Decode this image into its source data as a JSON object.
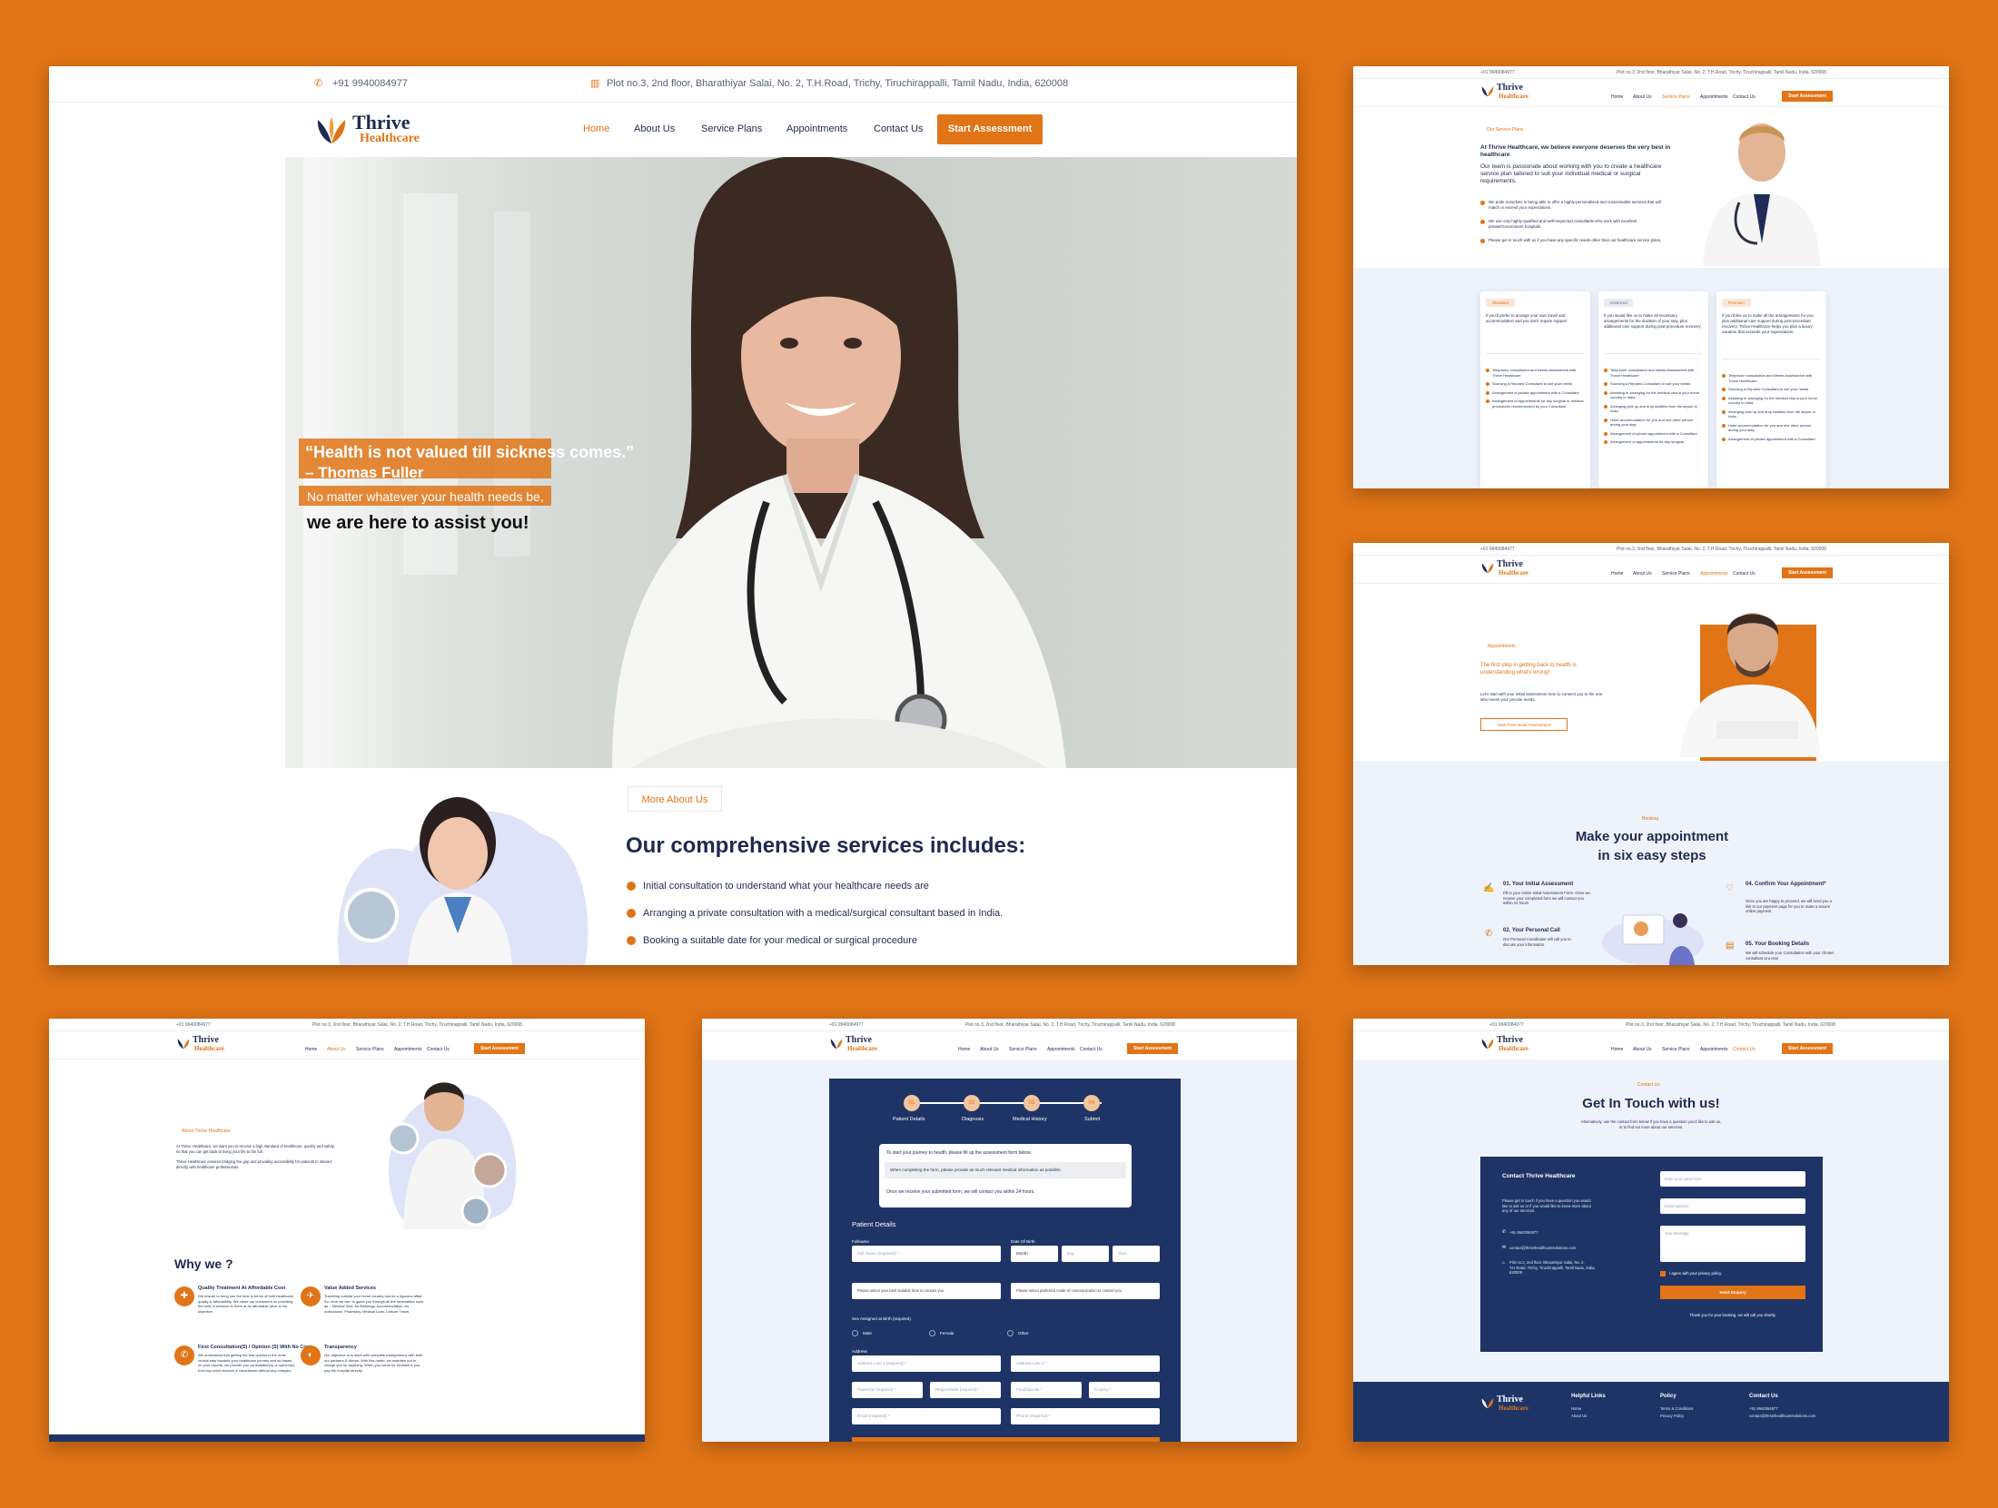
{
  "brand": {
    "name_line1": "Thrive",
    "name_line2": "Healthcare",
    "accent": "#e07416",
    "navy": "#1e2b4f"
  },
  "topbar": {
    "phone": "+91 9940084977",
    "address": "Plot no.3, 2nd floor, Bharathiyar Salai, No. 2, T.H.Road, Trichy, Tiruchirappalli, Tamil Nadu, India, 620008"
  },
  "nav": {
    "home": "Home",
    "about": "About Us",
    "plans": "Service Plans",
    "appointments": "Appointments",
    "contact": "Contact Us",
    "cta": "Start Assessment"
  },
  "hero": {
    "quote_line1": "“Health is not valued till sickness comes.”",
    "quote_line2": "– Thomas Fuller",
    "tagline1": "No matter whatever your health needs be,",
    "tagline2": "we are here to assist you!"
  },
  "services": {
    "more_button": "More About Us",
    "heading": "Our comprehensive services includes:",
    "items": [
      "Initial consultation to understand what your healthcare needs are",
      "Arranging a private consultation with a medical/surgical consultant based in India.",
      "Booking a suitable date for your medical or surgical procedure"
    ]
  },
  "plans_page": {
    "kicker": "Our Service Plans",
    "headline": "At Thrive Healthcare, we believe everyone deserves the very best in healthcare",
    "intro": "Our team is passionate about working with you to create a healthcare service plan tailored to suit your individual medical or surgical requirements.",
    "bullets": [
      "We pride ourselves in being able to offer a highly-personalised and customisable services that will match or exceed your expectations.",
      "We use only highly-qualified and well-respected consultants who work with excellent private/Government hospitals.",
      "Please get in touch with us if you have any specific needs other than our healthcare service plans."
    ],
    "cards": [
      {
        "badge": "Standard",
        "desc": "If you'd prefer to arrange your own travel and accommodation and you don't require support",
        "items": [
          "Telephone consultation and Needs Assessment with Thrive Healthcare",
          "Sourcing a Reputed Consultant to suit your needs",
          "Arrangement of private appointment with a Consultant",
          "Arrangement of appointments for any surgical or medical procedures recommended by your Consultant"
        ]
      },
      {
        "badge": "Advanced",
        "desc": "If you would like us to make all necessary arrangements for the duration of your stay, plus additional care support during post-procedure recovery",
        "items": [
          "Telephone consultation and Needs Assessment with Thrive Healthcare",
          "Sourcing a Reputed Consultant to suit your needs",
          "Assisting in arranging for the medical visa in your home country to India",
          "Arranging pick up and drop facilities from the airport in India",
          "Hotel accommodation for you and one other person during your stay",
          "Arrangement of private appointment with a Consultant",
          "Arrangement of appointments for any surgical"
        ]
      },
      {
        "badge": "Premium",
        "desc": "If you'd like us to make all the arrangements for you, plus additional care support during post-procedure recovery. Thrive Healthcare helps you plan a luxury vacation that exceeds your expectations.",
        "items": [
          "Telephone consultation and Needs Assessment with Thrive Healthcare",
          "Sourcing a Reputed Consultant to suit your needs",
          "Assisting in arranging for the medical visa in your home country to India",
          "Arranging pick up and drop facilities from the airport in India",
          "Hotel accommodation for you and one other person during your stay",
          "Arrangement of private appointment with a Consultant"
        ]
      }
    ]
  },
  "appt_page": {
    "kicker": "Appointments",
    "headline": "The first step in getting back to health is understanding what's wrong!",
    "body": "Let's start with your initial assessment here to connect you to the one who meets your precise needs.",
    "button": "Start Free Initial Assessment",
    "booking_kicker": "Booking",
    "booking_title1": "Make your appointment",
    "booking_title2": "in six easy steps",
    "steps": [
      {
        "title": "01. Your Initial Assessment",
        "text": "Fill in your online Initial Assessment Form. Once we receive your completed form we will contact you within 24 hours"
      },
      {
        "title": "02. Your Personal Call",
        "text": "Our Personal Coordinator will call you to discuss your information."
      },
      {
        "title": "04. Confirm Your Appointment*",
        "text": "Once you are happy to proceed, we will send you a link to our payment page for you to make a secure online payment"
      },
      {
        "title": "05. Your Booking Details",
        "text": "We will schedule your Consultation with your chosen consultant at a time"
      }
    ]
  },
  "about_page": {
    "kicker": "About Thrive Healthcare",
    "p1": "At Thrive Healthcare, we want you to receive a high standard of healthcare, quickly and safely, so that you can get back to living your life to the full.",
    "p2": "Thrive Healthcare ensures bridging the gap and providing accessibility for patients to interact directly with healthcare professionals.",
    "why_title": "Why we ?",
    "features": [
      {
        "title": "Quality Treatment At Affordable Cost",
        "text": "We ensure to bring you the best in terms of both healthcare quality & affordability. We value our customers so providing the best of services to them at an affordable price is our objective."
      },
      {
        "title": "Value Added Services",
        "text": "Travelling outside your home country can be a rigorous affair. So, here we are, to guide you through all the necessities such as – Medical Visa, Air Bookings, Accommodation, Air Ambulance, Pharmacy, Medical Loan, Leisure Travel."
      },
      {
        "title": "First Consultation(S) / Opinion (S) With No Cost",
        "text": "We understand that getting the first opinion is the most crucial step towards your healthcare journey and so based on your reports, we provide you consultation(s) or opinion(s) from top-notch doctors & consultants without any charges."
      },
      {
        "title": "Transparency",
        "text": "Our objective is to work with complete transparency with both our partners & clients. With this motto, we maintain not to charge you for anything. When you come for treatment, you pay the hospital directly."
      }
    ]
  },
  "form_page": {
    "steps": [
      {
        "num": "01",
        "label": "Patient Details"
      },
      {
        "num": "02",
        "label": "Diagnosis"
      },
      {
        "num": "03",
        "label": "Medical History"
      },
      {
        "num": "04",
        "label": "Submit"
      }
    ],
    "note1": "To start your journey to health, please fill up the assessment form below.",
    "note2": "When completing the form, please provide as much relevant medical information as possible.",
    "note3": "Once we receive your submitted form, we will contact you within 24 hours.",
    "section": "Patient Details",
    "fullname_label": "Fullname",
    "fullname_ph": "Full Name (required) *",
    "dob_label": "Date Of Birth",
    "month": "Month",
    "day": "Day",
    "year": "Year",
    "time_ph": "Please select your best suitable time to contact you",
    "mode_ph": "Please select preferred mode of communication to contact you",
    "sex_label": "Sex Assigned at Birth (required)",
    "male": "Male",
    "female": "Female",
    "other": "Other",
    "address_label": "Address",
    "addr1": "Address Line 1 (required) *",
    "addr2": "Address Line 2 *",
    "town": "Town/City (required) *",
    "region": "Region/State (required) *",
    "post": "Post/Zipcode *",
    "country": "Country *",
    "email": "Email (required) *",
    "phone": "Phone (required) *"
  },
  "contact_page": {
    "kicker": "Contact Us",
    "title": "Get In Touch with us!",
    "subtitle": "Alternatively, use the contact form below if you have a question you'd like to ask us, or to find out more about our services.",
    "box_title": "Contact Thrive Healthcare",
    "box_text": "Please get in touch if you have a question you would like to ask us or if you would like to know more about any of our services.",
    "phone": "+91 9940084977",
    "email": "contact@thrivehealthcaresolutions.com",
    "address": "Plot no.3, 2nd floor, Bharathiyar Salai, No. 2, T.H.Road, Trichy, Tiruchirappalli, Tamil Nadu, India, 620008",
    "name_ph": "Enter your name here",
    "email_ph": "Email address",
    "msg_ph": "Your Message",
    "agree": "I agree with your privacy policy.",
    "send": "Send Enquiry",
    "thanks": "Thank you for your booking, we will call you shortly.",
    "footer": {
      "helpful": "Helpful Links",
      "policy": "Policy",
      "contact": "Contact Us",
      "links": [
        "Home",
        "About Us"
      ],
      "policies": [
        "Terms & Conditions",
        "Privacy Policy"
      ],
      "phone": "+91 9940084977",
      "email": "contact@thrivehealthcaresolutions.com"
    }
  }
}
